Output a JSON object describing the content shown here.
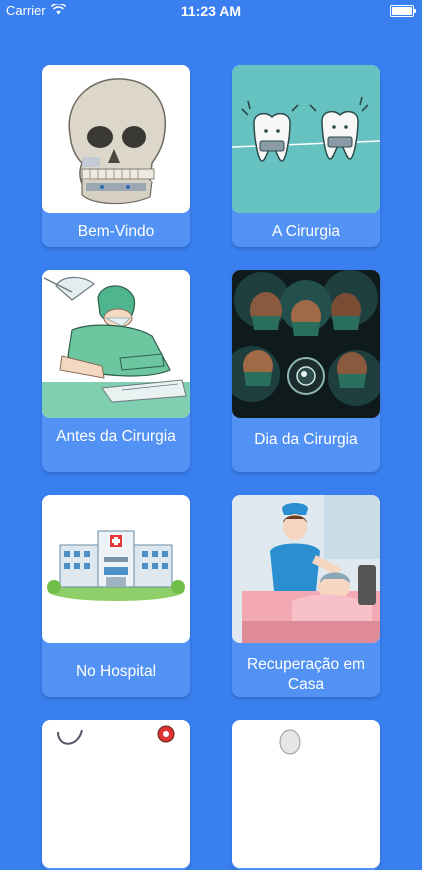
{
  "status_bar": {
    "carrier": "Carrier",
    "time": "11:23 AM"
  },
  "menu": {
    "items": [
      {
        "label": "Bem-Vindo",
        "image": "skull-illustration"
      },
      {
        "label": "A Cirurgia",
        "image": "teeth-braces-illustration"
      },
      {
        "label": "Antes da Cirurgia",
        "image": "surgeon-illustration"
      },
      {
        "label": "Dia da Cirurgia",
        "image": "surgical-team-illustration"
      },
      {
        "label": "No Hospital",
        "image": "hospital-building-illustration"
      },
      {
        "label": "Recuperação em Casa",
        "image": "nurse-patient-illustration"
      },
      {
        "label": "",
        "image": "stethoscope-illustration"
      },
      {
        "label": "",
        "image": "lamp-illustration"
      }
    ]
  },
  "colors": {
    "background": "#3a7ff0",
    "card": "#5292f5"
  }
}
